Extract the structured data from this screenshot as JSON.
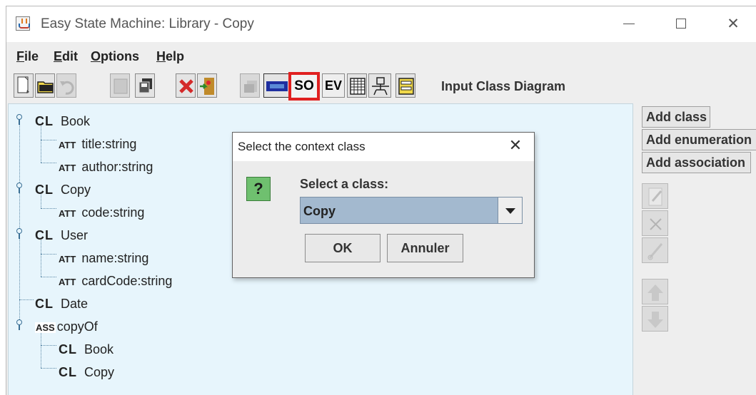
{
  "window": {
    "title": "Easy State Machine: Library - Copy",
    "minimize_glyph": "",
    "maximize_glyph": "",
    "close_glyph": "✕"
  },
  "menu": {
    "file": "File",
    "edit": "Edit",
    "options": "Options",
    "help": "Help"
  },
  "toolbar": {
    "so_label": "SO",
    "ev_label": "EV",
    "mode_label": "Input Class Diagram",
    "icons": [
      "new-file-icon",
      "open-folder-icon",
      "undo-icon",
      "save-icon",
      "save-all-icon",
      "delete-icon",
      "door-exit-icon",
      "copy-icon",
      "state-machine-icon",
      "so-icon",
      "ev-icon",
      "grid-icon",
      "robot-icon",
      "form-icon"
    ],
    "highlight_color": "#e02020"
  },
  "tree": {
    "nodes": [
      {
        "tag": "CL",
        "label": "Book"
      },
      {
        "tag": "ATT",
        "label": "title:string"
      },
      {
        "tag": "ATT",
        "label": "author:string"
      },
      {
        "tag": "CL",
        "label": "Copy"
      },
      {
        "tag": "ATT",
        "label": "code:string"
      },
      {
        "tag": "CL",
        "label": "User"
      },
      {
        "tag": "ATT",
        "label": "name:string"
      },
      {
        "tag": "ATT",
        "label": "cardCode:string"
      },
      {
        "tag": "CL",
        "label": "Date"
      },
      {
        "tag": "ASS",
        "label": "copyOf"
      },
      {
        "tag": "CL",
        "label": "Book"
      },
      {
        "tag": "CL",
        "label": "Copy"
      }
    ],
    "background": "#e7f5fc"
  },
  "side": {
    "add_class": "Add class",
    "add_enumeration": "Add enumeration",
    "add_association": "Add association"
  },
  "dialog": {
    "title": "Select  the  context class",
    "close_glyph": "✕",
    "question_glyph": "?",
    "prompt": "Select a class:",
    "selected_class": "Copy",
    "ok": "OK",
    "cancel": "Annuler"
  }
}
